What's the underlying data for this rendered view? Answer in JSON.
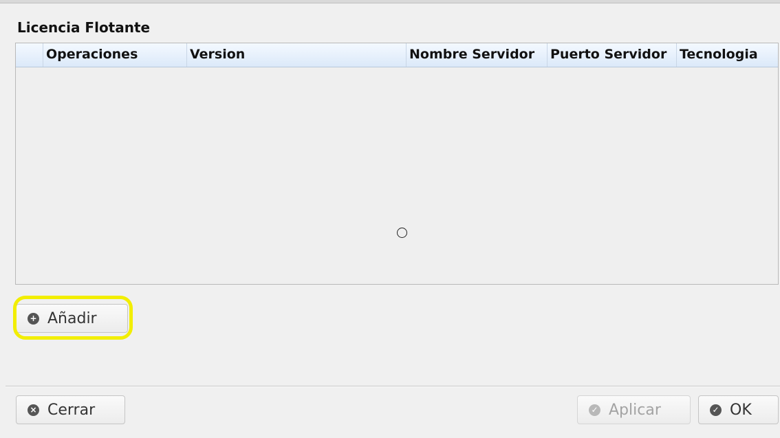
{
  "section": {
    "title": "Licencia Flotante"
  },
  "table": {
    "columns": [
      "",
      "Operaciones",
      "Version",
      "Nombre Servidor",
      "Puerto Servidor",
      "Tecnologia"
    ],
    "rows": []
  },
  "buttons": {
    "add": {
      "label": "Añadir",
      "icon": "plus-circle-icon"
    },
    "close": {
      "label": "Cerrar",
      "icon": "close-circle-icon"
    },
    "apply": {
      "label": "Aplicar",
      "icon": "check-circle-icon",
      "disabled": true
    },
    "ok": {
      "label": "OK",
      "icon": "check-circle-icon"
    }
  },
  "colors": {
    "highlight": "#f2ee00",
    "header_gradient_top": "#f4f9ff",
    "header_gradient_bottom": "#dbe9f9"
  }
}
